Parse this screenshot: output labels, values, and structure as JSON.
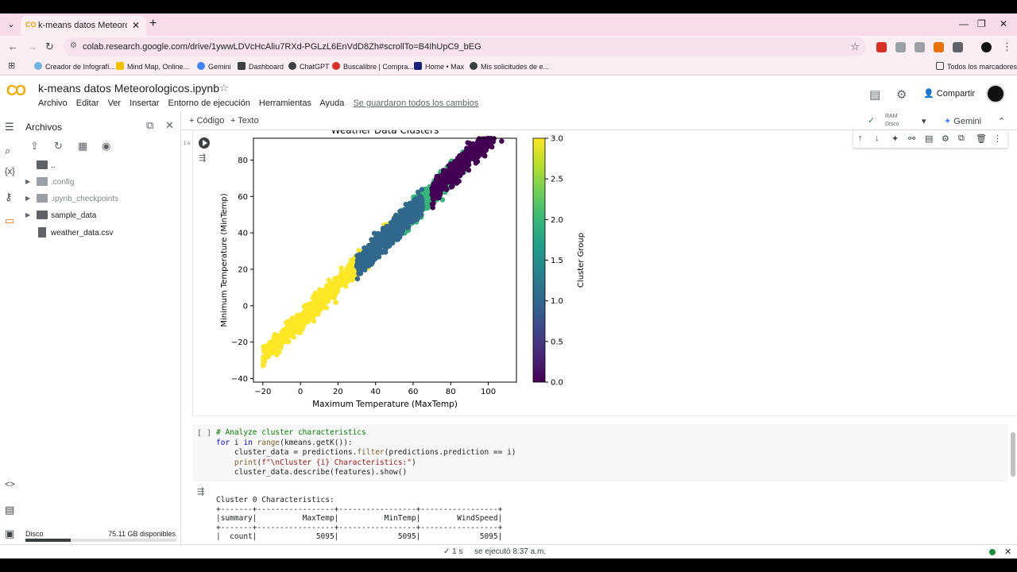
{
  "browser": {
    "tab_title": "k-means datos Meteorologicos.ipynb",
    "tab_logo": "CO",
    "url": "colab.research.google.com/drive/1ywwLDVcHcAliu7RXd-PGLzL6EnVdD8Zh#scrollTo=B4IhUpC9_bEG",
    "bookmarks": [
      "Creador de Infografí...",
      "Mind Map, Online...",
      "Gemini",
      "Dashboard",
      "ChatGPT",
      "Buscalibre | Compra...",
      "Home • Max",
      "Mis solicitudes de e..."
    ],
    "all_bookmarks": "Todos los marcadores"
  },
  "colab": {
    "logo": "CO",
    "notebook_title": "k-means datos Meteorologicos.ipynb",
    "menu": [
      "Archivo",
      "Editar",
      "Ver",
      "Insertar",
      "Entorno de ejecución",
      "Herramientas",
      "Ayuda"
    ],
    "saved_status": "Se guardaron todos los cambios",
    "share_label": "Compartir"
  },
  "files_panel": {
    "title": "Archivos",
    "items": [
      {
        "name": "..",
        "type": "folder-up"
      },
      {
        "name": ".config",
        "type": "folder"
      },
      {
        "name": ".ipynb_checkpoints",
        "type": "folder"
      },
      {
        "name": "sample_data",
        "type": "folder"
      },
      {
        "name": "weather_data.csv",
        "type": "file"
      }
    ],
    "disk_label": "Disco",
    "disk_free": "75.11 GB disponibles",
    "disk_used_fraction": 0.3
  },
  "toolbar": {
    "code_btn": "+ Código",
    "text_btn": "+ Texto",
    "ram_label": "RAM",
    "disk_label": "Disco",
    "gemini_label": "Gemini"
  },
  "cell1": {
    "exec_time": "1 s"
  },
  "chart_data": {
    "type": "scatter",
    "title": "Weather Data Clusters",
    "xlabel": "Maximum Temperature (MaxTemp)",
    "ylabel": "Minimum Temperature (MinTemp)",
    "xlim": [
      -25,
      115
    ],
    "ylim": [
      -42,
      92
    ],
    "xticks": [
      -20,
      0,
      20,
      40,
      60,
      80,
      100
    ],
    "yticks": [
      -40,
      -20,
      0,
      20,
      40,
      60,
      80
    ],
    "colorbar": {
      "label": "Cluster Group",
      "range": [
        0.0,
        3.0
      ],
      "ticks": [
        "0.0",
        "0.5",
        "1.0",
        "1.5",
        "2.0",
        "2.5",
        "3.0"
      ]
    },
    "clusters": [
      {
        "id": 0,
        "color": "#440154",
        "x_range": [
          70,
          112
        ],
        "center": [
          88,
          70
        ]
      },
      {
        "id": 1,
        "color": "#31688e",
        "x_range": [
          30,
          65
        ],
        "center": [
          52,
          28
        ]
      },
      {
        "id": 2,
        "color": "#35b779",
        "x_range": [
          53,
          90
        ],
        "center": [
          71,
          48
        ]
      },
      {
        "id": 3,
        "color": "#fde725",
        "x_range": [
          -20,
          52
        ],
        "center": [
          25,
          5
        ]
      }
    ]
  },
  "cell2": {
    "bracket": "[ ]",
    "code_lines": [
      "# Analyze cluster characteristics",
      "for i in range(kmeans.getK()):",
      "    cluster_data = predictions.filter(predictions.prediction == i)",
      "    print(f\"\\nCluster {i} Characteristics:\")",
      "    cluster_data.describe(features).show()"
    ],
    "output_lines": [
      "Cluster 0 Characteristics:",
      "+-------+-----------------+-----------------+-----------------+",
      "|summary|          MaxTemp|          MinTemp|        WindSpeed|",
      "+-------+-----------------+-----------------+-----------------+",
      "|  count|             5095|             5095|             5095|"
    ]
  },
  "statusbar": {
    "check": "✓ 1 s",
    "text": "se ejecutó 8:37 a.m."
  }
}
